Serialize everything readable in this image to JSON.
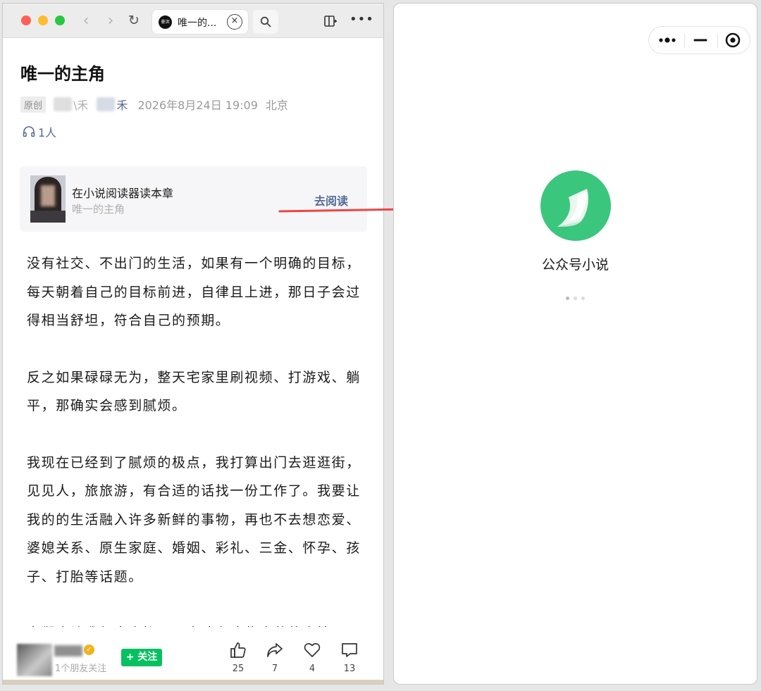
{
  "browser": {
    "tab_title": "唯一的...",
    "tab_favicon_text": "豪洪",
    "tab_close_glyph": "×"
  },
  "article": {
    "title": "唯一的主角",
    "original_tag": "原创",
    "author_fragment_1": "\\禾",
    "author_fragment_2": "禾",
    "date": "2026年8月24日 19:09",
    "location": "北京",
    "listeners": "1人",
    "paragraphs": [
      "没有社交、不出门的生活，如果有一个明确的目标，每天朝着自己的目标前进，自律且上进，那日子会过得相当舒坦，符合自己的预期。",
      "反之如果碌碌无为，整天宅家里刷视频、打游戏、躺平，那确实会感到腻烦。",
      "我现在已经到了腻烦的极点，我打算出门去逛逛街，见见人，旅旅游，有合适的话找一份工作了。我要让我的的生活融入许多新鲜的事物，再也不去想恋爱、婆媳关系、原生家庭、婚姻、彩礼、三金、怀孕、孩子、打胎等话题。",
      "它们会让我想当自抑……事略在这些痛苦的事情"
    ]
  },
  "reader_card": {
    "title": "在小说阅读器读本章",
    "subtitle": "唯一的主角",
    "action": "去阅读"
  },
  "action_bar": {
    "friends_following": "1个朋友关注",
    "follow_label": "+ 关注",
    "like_count": "25",
    "share_count": "7",
    "favorite_count": "4",
    "comment_count": "13"
  },
  "mini_program": {
    "name": "公众号小说",
    "brand_color": "#3bc67e"
  },
  "colors": {
    "link_blue": "#576b95",
    "follow_green": "#07c160",
    "arrow_red": "#ee4444"
  }
}
